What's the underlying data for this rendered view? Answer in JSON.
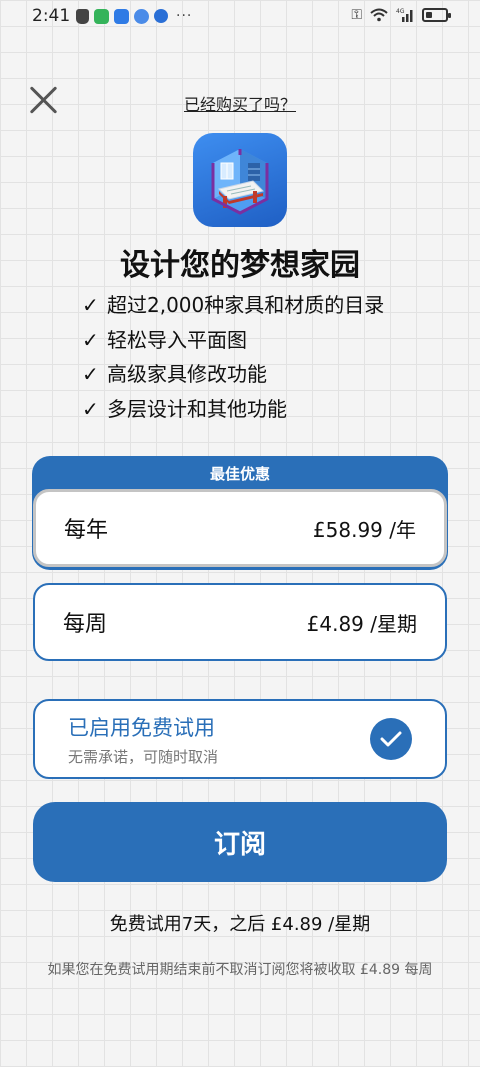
{
  "status_bar": {
    "time": "2:41",
    "more_indicator": "···",
    "network_label": "4G",
    "battery_level": 0.35,
    "notification_icons": [
      "cat-app-icon",
      "wechat-style-green-icon",
      "cloud-blue-icon",
      "music-circle-icon",
      "bulb-blue-icon"
    ],
    "system_icons": [
      "key-icon",
      "wifi-icon",
      "signal-icon",
      "battery-icon"
    ]
  },
  "header": {
    "close_icon": "close-icon",
    "restore_link": "已经购买了吗？"
  },
  "app": {
    "icon": "room-design-app-icon",
    "headline": "设计您的梦想家园"
  },
  "features": [
    "超过2,000种家具和材质的目录",
    "轻松导入平面图",
    "高级家具修改功能",
    "多层设计和其他功能"
  ],
  "features_check_glyph": "✓",
  "plans": {
    "best_offer_label": "最佳优惠",
    "yearly": {
      "name": "每年",
      "price": "£58.99 /年"
    },
    "weekly": {
      "name": "每周",
      "price": "£4.89 /星期"
    }
  },
  "trial": {
    "title": "已启用免费试用",
    "subtitle": "无需承诺，可随时取消",
    "enabled": true
  },
  "subscribe_button": "订阅",
  "trial_info": "免费试用7天，之后 £4.89 /星期",
  "disclaimer": "如果您在免费试用期结束前不取消订阅您将被收取 £4.89 每周",
  "colors": {
    "accent": "#2a6fb8",
    "background": "#f4f4f4",
    "grid": "#e2e2e2"
  }
}
